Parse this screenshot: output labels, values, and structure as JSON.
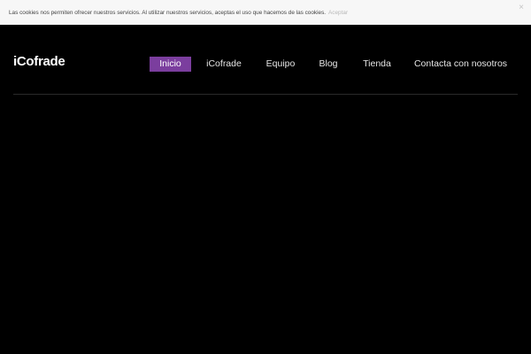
{
  "cookie_bar": {
    "message": "Las cookies nos permiten ofrecer nuestros servicios. Al utilizar nuestros servicios, aceptas el uso que hacemos de las cookies.",
    "accept_label": "Aceptar",
    "close_label": "×"
  },
  "header": {
    "logo_text": "iCofrade"
  },
  "nav": {
    "items": [
      {
        "label": "Inicio",
        "active": true
      },
      {
        "label": "iCofrade",
        "active": false
      },
      {
        "label": "Equipo",
        "active": false
      },
      {
        "label": "Blog",
        "active": false
      },
      {
        "label": "Tienda",
        "active": false
      },
      {
        "label": "Contacta con nosotros",
        "active": false
      }
    ]
  },
  "colors": {
    "accent": "#7b3e9e",
    "background": "#000000",
    "cookie_bar_bg": "#f7f7f7"
  }
}
